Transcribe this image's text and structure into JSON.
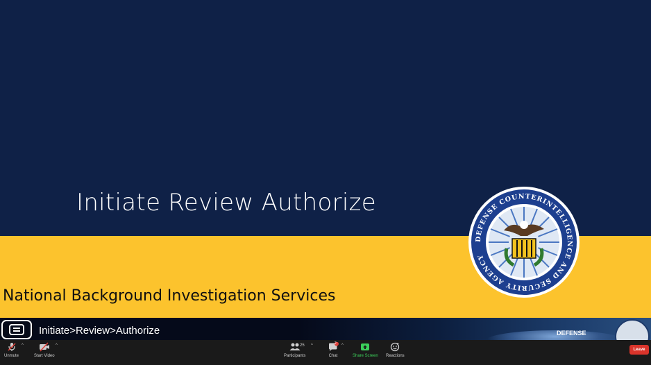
{
  "slide": {
    "title": "Initiate Review Authorize",
    "subtitle": "National Background Investigation Services",
    "colors": {
      "navy": "#0f2147",
      "gold": "#fcc32d"
    },
    "seal_text": "DEFENSE COUNTERINTELLIGENCE AND SECURITY AGENCY"
  },
  "banner": {
    "text": "Initiate>Review>Authorize",
    "defense_label": "DEFENSE"
  },
  "toolbar": {
    "unmute": "Unmute",
    "start_video": "Start Video",
    "participants": "Participants",
    "participant_count": "25",
    "chat": "Chat",
    "chat_badge": "2",
    "share_screen": "Share Screen",
    "reactions": "Reactions",
    "leave": "Leave",
    "icons": [
      "microphone-muted-icon",
      "video-off-icon",
      "participants-icon",
      "chat-icon",
      "share-screen-icon",
      "reactions-icon"
    ],
    "colors": {
      "leave": "#d9342b",
      "share": "#3ccf5a"
    }
  }
}
